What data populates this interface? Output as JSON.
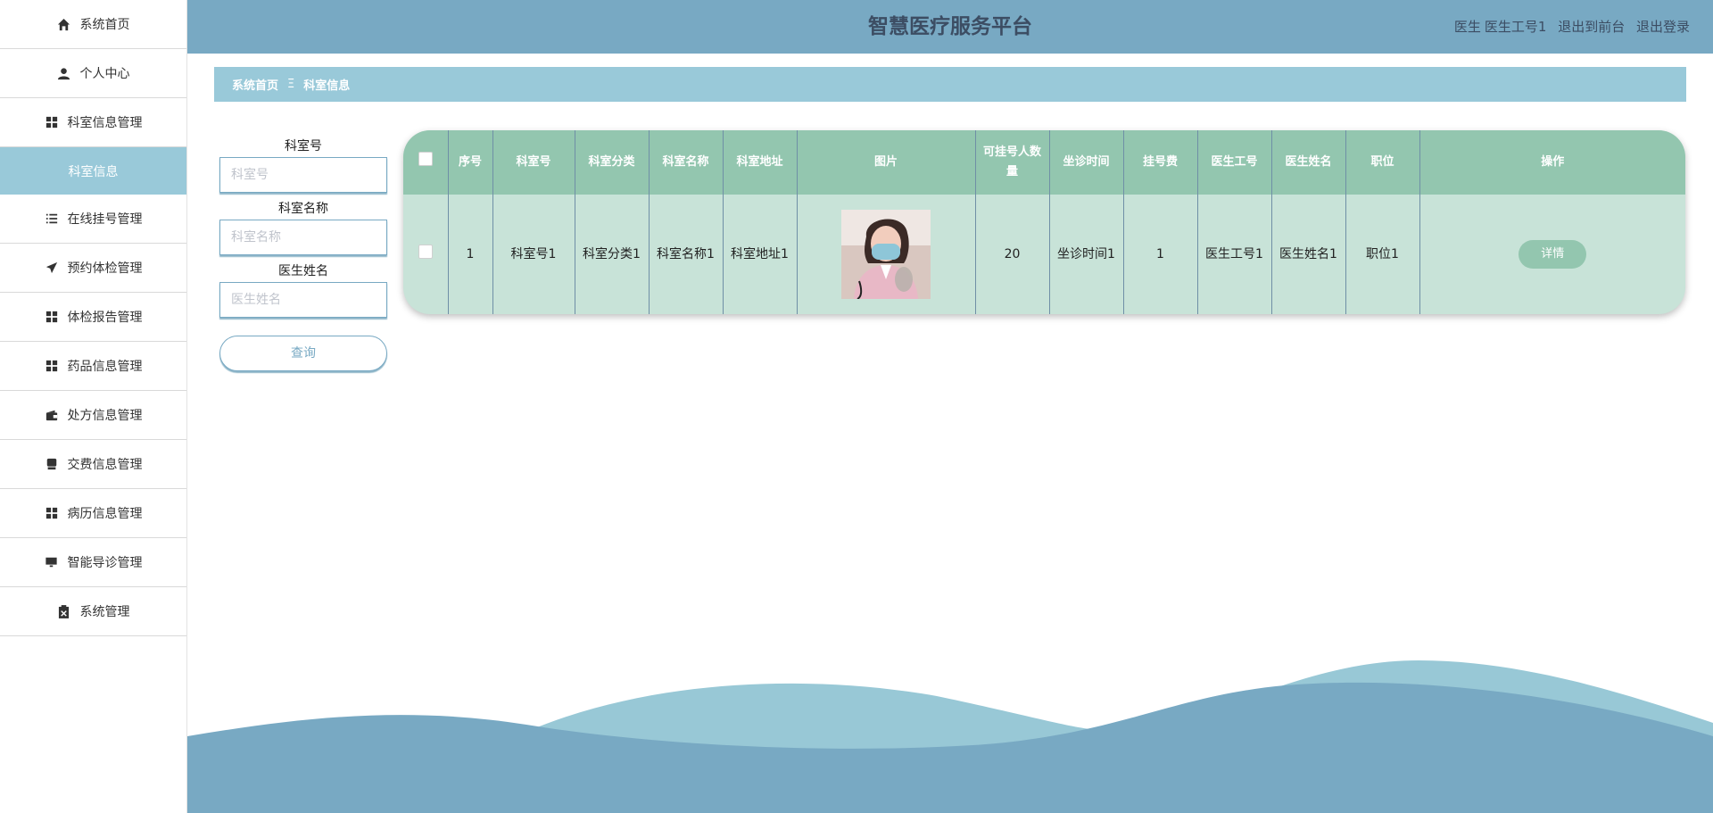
{
  "sidebar": {
    "items": [
      {
        "label": "系统首页",
        "icon": "home-icon"
      },
      {
        "label": "个人中心",
        "icon": "user-icon"
      },
      {
        "label": "科室信息管理",
        "icon": "grid-icon"
      },
      {
        "label": "科室信息",
        "icon": ""
      },
      {
        "label": "在线挂号管理",
        "icon": "list-icon"
      },
      {
        "label": "预约体检管理",
        "icon": "paper-plane-icon"
      },
      {
        "label": "体检报告管理",
        "icon": "grid-icon"
      },
      {
        "label": "药品信息管理",
        "icon": "grid-icon"
      },
      {
        "label": "处方信息管理",
        "icon": "wallet-icon"
      },
      {
        "label": "交费信息管理",
        "icon": "printer-icon"
      },
      {
        "label": "病历信息管理",
        "icon": "grid-icon"
      },
      {
        "label": "智能导诊管理",
        "icon": "monitor-icon"
      },
      {
        "label": "系统管理",
        "icon": "clipboard-icon"
      }
    ]
  },
  "header": {
    "title": "智慧医疗服务平台",
    "user_role": "医生",
    "user_name": "医生工号1",
    "exit_front": "退出到前台",
    "logout": "退出登录"
  },
  "breadcrumb": {
    "home": "系统首页",
    "separator": "Ξ",
    "current": "科室信息"
  },
  "search": {
    "dept_no_label": "科室号",
    "dept_no_placeholder": "科室号",
    "dept_name_label": "科室名称",
    "dept_name_placeholder": "科室名称",
    "doctor_name_label": "医生姓名",
    "doctor_name_placeholder": "医生姓名",
    "query_button": "查询"
  },
  "table": {
    "headers": {
      "index": "序号",
      "dept_no": "科室号",
      "category": "科室分类",
      "dept_name": "科室名称",
      "address": "科室地址",
      "image": "图片",
      "capacity": "可挂号人数量",
      "time": "坐诊时间",
      "fee": "挂号费",
      "doc_no": "医生工号",
      "doc_name": "医生姓名",
      "position": "职位",
      "action": "操作"
    },
    "rows": [
      {
        "index": "1",
        "dept_no": "科室号1",
        "category": "科室分类1",
        "dept_name": "科室名称1",
        "address": "科室地址1",
        "capacity": "20",
        "time": "坐诊时间1",
        "fee": "1",
        "doc_no": "医生工号1",
        "doc_name": "医生姓名1",
        "position": "职位1",
        "action": "详情"
      }
    ]
  },
  "colors": {
    "header_bg": "#78a9c3",
    "breadcrumb_bg": "#99c9d9",
    "table_header_bg": "#93c6af",
    "table_row_bg": "#c8e3d8"
  }
}
